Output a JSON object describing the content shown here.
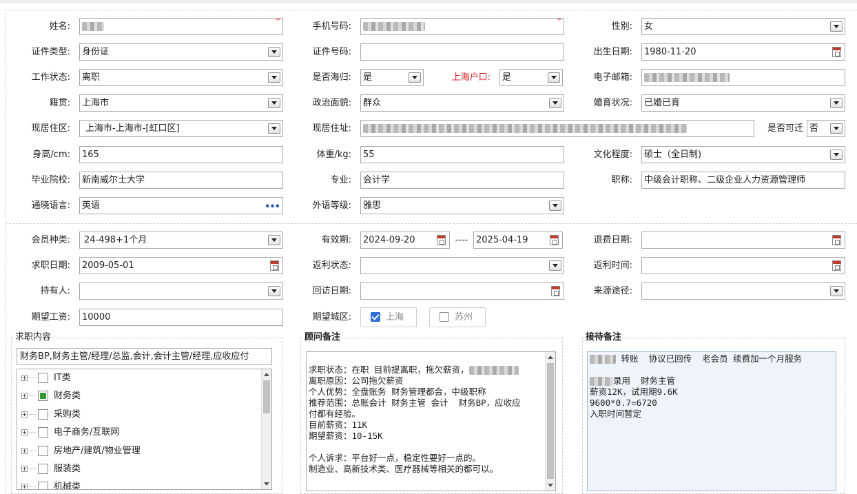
{
  "basic": {
    "name": {
      "label": "姓名:",
      "required_mark": "*"
    },
    "phone": {
      "label": "手机号码:",
      "required_mark": "*"
    },
    "gender": {
      "label": "性别:",
      "value": "女"
    },
    "id_type": {
      "label": "证件类型:",
      "value": "身份证"
    },
    "id_number": {
      "label": "证件号码:",
      "value": ""
    },
    "birth_date": {
      "label": "出生日期:",
      "value": "1980-11-20"
    },
    "work_status": {
      "label": "工作状态:",
      "value": "离职"
    },
    "returnee": {
      "label": "是否海归:",
      "value": "是"
    },
    "hukou": {
      "label": "上海户口:",
      "value": "是"
    },
    "email": {
      "label": "电子邮箱:"
    },
    "native_place": {
      "label": "籍贯:",
      "value": "上海市"
    },
    "political": {
      "label": "政治面貌:",
      "value": "群众"
    },
    "marital": {
      "label": "婚育状况:",
      "value": "已婚已育"
    },
    "residence_area": {
      "label": "现居住区:",
      "value": "上海市-上海市-[虹口区]"
    },
    "residence_addr": {
      "label": "现居住址:"
    },
    "relocate": {
      "label": "是否可迁",
      "value": "否"
    },
    "height": {
      "label": "身高/cm:",
      "value": "165"
    },
    "weight": {
      "label": "体重/kg:",
      "value": "55"
    },
    "education": {
      "label": "文化程度:",
      "value": "硕士（全日制)"
    },
    "school": {
      "label": "毕业院校:",
      "value": "新南威尔士大学"
    },
    "major": {
      "label": "专业:",
      "value": "会计学"
    },
    "title": {
      "label": "职称:",
      "value": "中级会计职称、二级企业人力资源管理师"
    },
    "language": {
      "label": "通晓语言:",
      "value": "英语",
      "more": "•••"
    },
    "lang_level": {
      "label": "外语等级:",
      "value": "雅思"
    }
  },
  "member": {
    "type": {
      "label": "会员种类:",
      "value": "24-498+1个月"
    },
    "validity": {
      "label": "有效期:",
      "start": "2024-09-20",
      "sep": "----",
      "end": "2025-04-19"
    },
    "refund_date": {
      "label": "退费日期:",
      "value": ""
    },
    "job_date": {
      "label": "求职日期:",
      "value": "2009-05-01"
    },
    "rebate_status": {
      "label": "返利状态:",
      "value": ""
    },
    "rebate_time": {
      "label": "返利时间:",
      "value": ""
    },
    "holder": {
      "label": "持有人:",
      "value": ""
    },
    "revisit_date": {
      "label": "回访日期:",
      "value": ""
    },
    "source": {
      "label": "来源途径:",
      "value": ""
    },
    "salary": {
      "label": "期望工资:",
      "value": "10000"
    },
    "city": {
      "label": "期望城区:",
      "options": [
        {
          "label": "上海",
          "checked": true
        },
        {
          "label": "苏州",
          "checked": false
        }
      ]
    }
  },
  "job_content": {
    "legend": "求职内容",
    "selected": "财务BP,财务主管/经理/总监,会计,会计主管/经理,应收应付",
    "tree": [
      {
        "label": "IT类",
        "checked": false
      },
      {
        "label": "财务类",
        "checked": true
      },
      {
        "label": "采购类",
        "checked": false
      },
      {
        "label": "电子商务/互联网",
        "checked": false
      },
      {
        "label": "房地产/建筑/物业管理",
        "checked": false
      },
      {
        "label": "服装类",
        "checked": false
      },
      {
        "label": "机械类",
        "checked": false
      }
    ]
  },
  "advisor_note": {
    "legend": "顾问备注",
    "lines": [
      "",
      "求职状态：在职 目前提离职，拖欠薪资，",
      "离职原因：公司拖欠薪资",
      "个人优势：全盘账务 财务管理都会，中级职称",
      "推荐范围：总账会计 财务主管 会计  财务BP，应收应",
      "付都有经验。",
      "目前薪资：11K",
      "期望薪资：10-15K",
      "",
      "个人诉求：平台好一点，稳定性要好一点的。",
      "制造业、高新技术类、医疗器械等相关的都可以。"
    ]
  },
  "reception_note": {
    "legend": "接待备注",
    "lines": [
      "转账  协议已回传  老会员 续费加一个月服务",
      "",
      "录用  财务主管",
      "薪资12K，试用期9.6K",
      "9600*0.7=6720",
      "入职时间暂定"
    ]
  }
}
